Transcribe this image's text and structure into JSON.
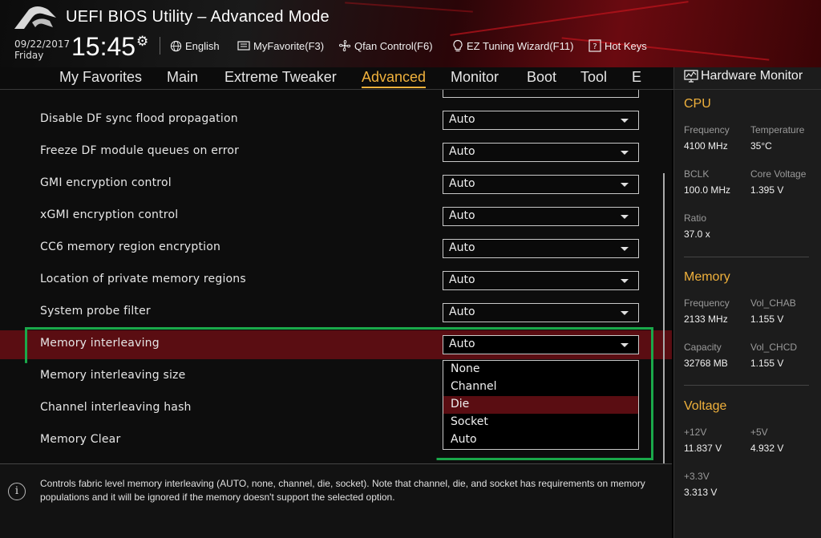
{
  "header": {
    "title": "UEFI BIOS Utility – Advanced Mode",
    "date": "09/22/2017",
    "day": "Friday",
    "time": "15:45",
    "buttons": {
      "language": "English",
      "myfavorite": "MyFavorite(F3)",
      "qfan": "Qfan Control(F6)",
      "ez_tuning": "EZ Tuning Wizard(F11)",
      "hot_keys": "Hot Keys"
    },
    "icons": [
      "rog-logo",
      "gear-icon",
      "globe-icon",
      "favorite-icon",
      "fan-icon",
      "bulb-icon",
      "question-icon"
    ]
  },
  "nav": {
    "tabs": [
      "My Favorites",
      "Main",
      "Extreme Tweaker",
      "Advanced",
      "Monitor",
      "Boot",
      "Tool",
      "E"
    ],
    "active": "Advanced"
  },
  "settings": {
    "rows": [
      {
        "label": "Disable DF sync flood propagation",
        "value": "Auto"
      },
      {
        "label": "Freeze DF module queues on error",
        "value": "Auto"
      },
      {
        "label": "GMI encryption control",
        "value": "Auto"
      },
      {
        "label": "xGMI encryption control",
        "value": "Auto"
      },
      {
        "label": "CC6 memory region encryption",
        "value": "Auto"
      },
      {
        "label": "Location of private memory regions",
        "value": "Auto"
      },
      {
        "label": "System probe filter",
        "value": "Auto"
      },
      {
        "label": "Memory interleaving",
        "value": "Auto"
      },
      {
        "label": "Memory interleaving size",
        "value": ""
      },
      {
        "label": "Channel interleaving hash",
        "value": ""
      },
      {
        "label": "Memory Clear",
        "value": ""
      }
    ],
    "selected": "Memory interleaving",
    "open_options": [
      "None",
      "Channel",
      "Die",
      "Socket",
      "Auto"
    ],
    "highlighted_option": "Die"
  },
  "help": {
    "text": "Controls fabric level memory interleaving (AUTO, none, channel, die, socket). Note that channel, die, and socket has requirements on memory populations and it will be ignored if the memory doesn't support the selected option."
  },
  "hardware_monitor": {
    "title": "Hardware Monitor",
    "cpu": {
      "heading": "CPU",
      "frequency_label": "Frequency",
      "frequency": "4100 MHz",
      "temperature_label": "Temperature",
      "temperature": "35°C",
      "bclk_label": "BCLK",
      "bclk": "100.0 MHz",
      "core_voltage_label": "Core Voltage",
      "core_voltage": "1.395 V",
      "ratio_label": "Ratio",
      "ratio": "37.0 x"
    },
    "memory": {
      "heading": "Memory",
      "frequency_label": "Frequency",
      "frequency": "2133 MHz",
      "vol_chab_label": "Vol_CHAB",
      "vol_chab": "1.155 V",
      "capacity_label": "Capacity",
      "capacity": "32768 MB",
      "vol_chcd_label": "Vol_CHCD",
      "vol_chcd": "1.155 V"
    },
    "voltage": {
      "heading": "Voltage",
      "v12_label": "+12V",
      "v12": "11.837 V",
      "v5_label": "+5V",
      "v5": "4.932 V",
      "v33_label": "+3.3V",
      "v33": "3.313 V"
    }
  },
  "colors": {
    "accent": "#f0b13c",
    "selection": "#5a0d12",
    "highlight_box": "#1aa84a",
    "header_red": "#6a0a10"
  }
}
